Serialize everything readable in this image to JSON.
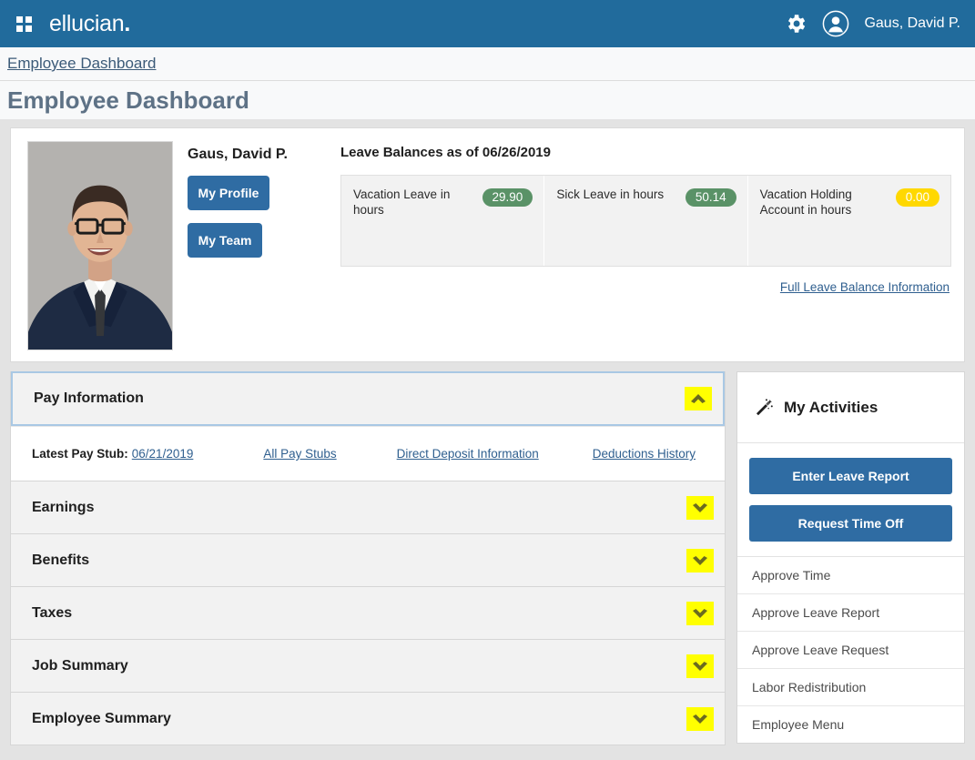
{
  "topbar": {
    "waffle_icon": "grid-menu-icon",
    "brand": "ellucian",
    "brand_dot": ".",
    "gear_icon": "gear-icon",
    "avatar_icon": "user-avatar-icon",
    "user_name": "Gaus, David P."
  },
  "breadcrumb": {
    "item": "Employee Dashboard"
  },
  "page": {
    "title": "Employee Dashboard"
  },
  "profile": {
    "photo_alt": "employee-portrait",
    "name": "Gaus, David P.",
    "my_profile_label": "My Profile",
    "my_team_label": "My Team"
  },
  "leave": {
    "title": "Leave Balances as of 06/26/2019",
    "balances": [
      {
        "label": "Vacation Leave in hours",
        "value": "29.90",
        "color": "#5a9267",
        "tone": "green"
      },
      {
        "label": "Sick Leave in hours",
        "value": "50.14",
        "color": "#5a9267",
        "tone": "green"
      },
      {
        "label": "Vacation Holding Account in hours",
        "value": "0.00",
        "color": "#ffd800",
        "tone": "yellow"
      }
    ],
    "full_info_link": "Full Leave Balance Information"
  },
  "pay_information": {
    "title": "Pay Information",
    "chevron_icon": "chevron-up-icon",
    "latest_pay_stub_label": "Latest Pay Stub:",
    "latest_pay_stub_date": "06/21/2019",
    "all_pay_stubs": "All Pay Stubs",
    "direct_deposit": "Direct Deposit Information",
    "deductions_history": "Deductions History"
  },
  "sections": [
    {
      "title": "Earnings",
      "chevron_icon": "chevron-down-icon"
    },
    {
      "title": "Benefits",
      "chevron_icon": "chevron-down-icon"
    },
    {
      "title": "Taxes",
      "chevron_icon": "chevron-down-icon"
    },
    {
      "title": "Job Summary",
      "chevron_icon": "chevron-down-icon"
    },
    {
      "title": "Employee Summary",
      "chevron_icon": "chevron-down-icon"
    }
  ],
  "activities": {
    "icon": "magic-wand-icon",
    "title": "My Activities",
    "buttons": [
      {
        "label": "Enter Leave Report"
      },
      {
        "label": "Request Time Off"
      }
    ],
    "links": [
      {
        "label": "Approve Time"
      },
      {
        "label": "Approve Leave Report"
      },
      {
        "label": "Approve Leave Request"
      },
      {
        "label": "Labor Redistribution"
      },
      {
        "label": "Employee Menu"
      }
    ]
  },
  "colors": {
    "header_blue": "#216b9c",
    "button_blue": "#2f6ca3",
    "link_blue": "#2f5f8f",
    "title_gray": "#5e7286",
    "highlight_yellow": "#ffff00",
    "badge_green": "#5a9267",
    "badge_yellow": "#ffd800"
  }
}
